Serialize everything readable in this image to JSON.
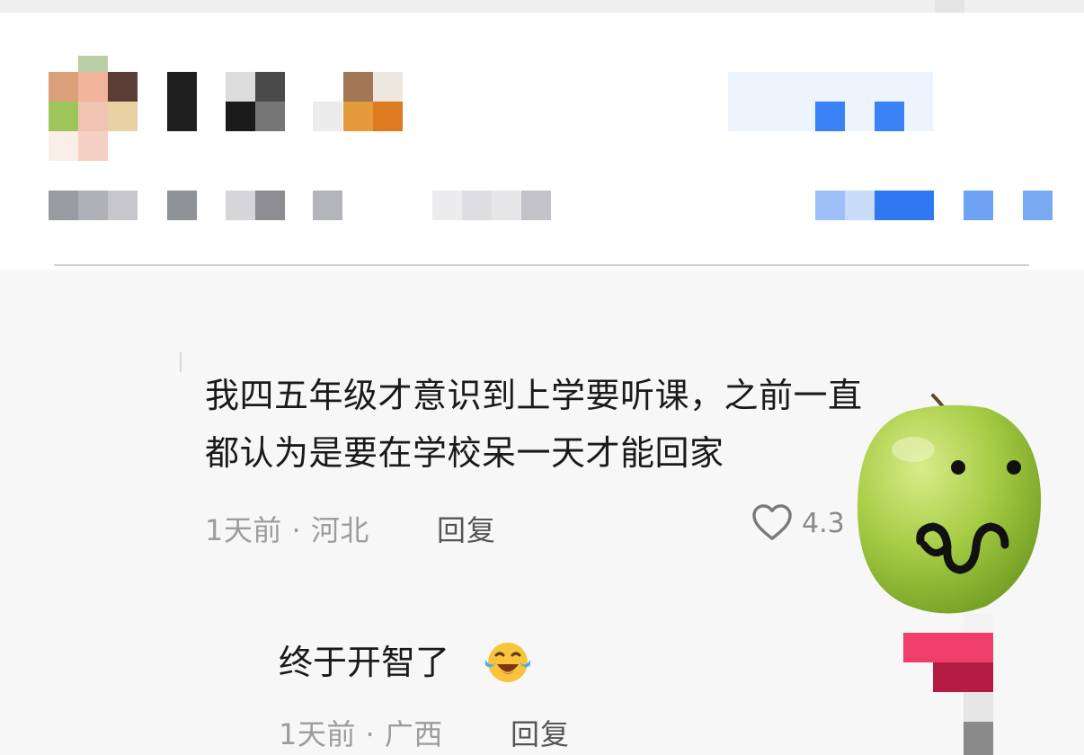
{
  "comment": {
    "line1": "我四五年级才意识到上学要听课，之前一直",
    "line2": "都认为是要在学校呆一天才能回家",
    "time": "1天前",
    "separator": "·",
    "location": "河北",
    "reply_label": "回复",
    "like_count": "4.3",
    "like_icon": "heart-outline-icon"
  },
  "reply": {
    "text": "终于开智了",
    "emoji": "crying-laughing-emoji",
    "time": "1天前",
    "separator": "·",
    "location": "广西",
    "reply_label": "回复"
  },
  "sticker": {
    "type": "green-apple-face-sticker",
    "face": "ω"
  },
  "colors": {
    "background": "#f7f7f7",
    "text": "#1a1a1a",
    "meta_text": "#9c9c9c",
    "redaction_blue": "#3b82f6"
  }
}
